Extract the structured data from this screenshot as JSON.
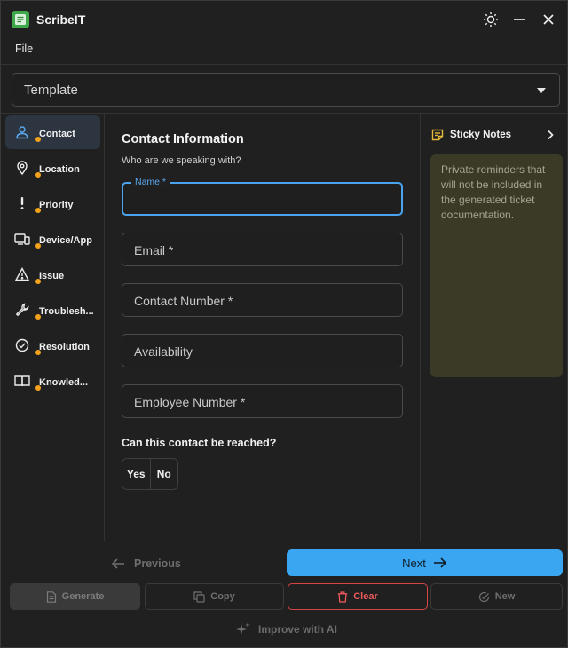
{
  "app": {
    "title": "ScribeIT"
  },
  "menu": {
    "file": "File"
  },
  "template": {
    "selected": "Template"
  },
  "sidebar": {
    "items": [
      {
        "label": "Contact",
        "icon": "person-icon",
        "active": true
      },
      {
        "label": "Location",
        "icon": "location-pin-icon"
      },
      {
        "label": "Priority",
        "icon": "exclamation-icon"
      },
      {
        "label": "Device/App",
        "icon": "devices-icon"
      },
      {
        "label": "Issue",
        "icon": "warning-triangle-icon"
      },
      {
        "label": "Troublesh...",
        "icon": "wrench-icon"
      },
      {
        "label": "Resolution",
        "icon": "check-circle-icon"
      },
      {
        "label": "Knowled...",
        "icon": "book-icon"
      }
    ]
  },
  "form": {
    "title": "Contact Information",
    "subtitle": "Who are we speaking with?",
    "fields": [
      {
        "label": "Name *",
        "value": "",
        "focused": true
      },
      {
        "label": "Email *",
        "value": ""
      },
      {
        "label": "Contact Number *",
        "value": ""
      },
      {
        "label": "Availability",
        "value": ""
      },
      {
        "label": "Employee Number *",
        "value": ""
      }
    ],
    "reach_question": "Can this contact be reached?",
    "yes": "Yes",
    "no": "No"
  },
  "sticky": {
    "title": "Sticky Notes",
    "placeholder": "Private reminders that will not be included in the generated ticket documentation."
  },
  "nav": {
    "previous": "Previous",
    "next": "Next"
  },
  "actions": {
    "generate": "Generate",
    "copy": "Copy",
    "clear": "Clear",
    "new": "New",
    "improve": "Improve with AI"
  },
  "colors": {
    "accent": "#3aa6f2",
    "status_dot": "#f3a21b",
    "danger": "#d64545",
    "sticky_bg": "#3b3a27"
  }
}
